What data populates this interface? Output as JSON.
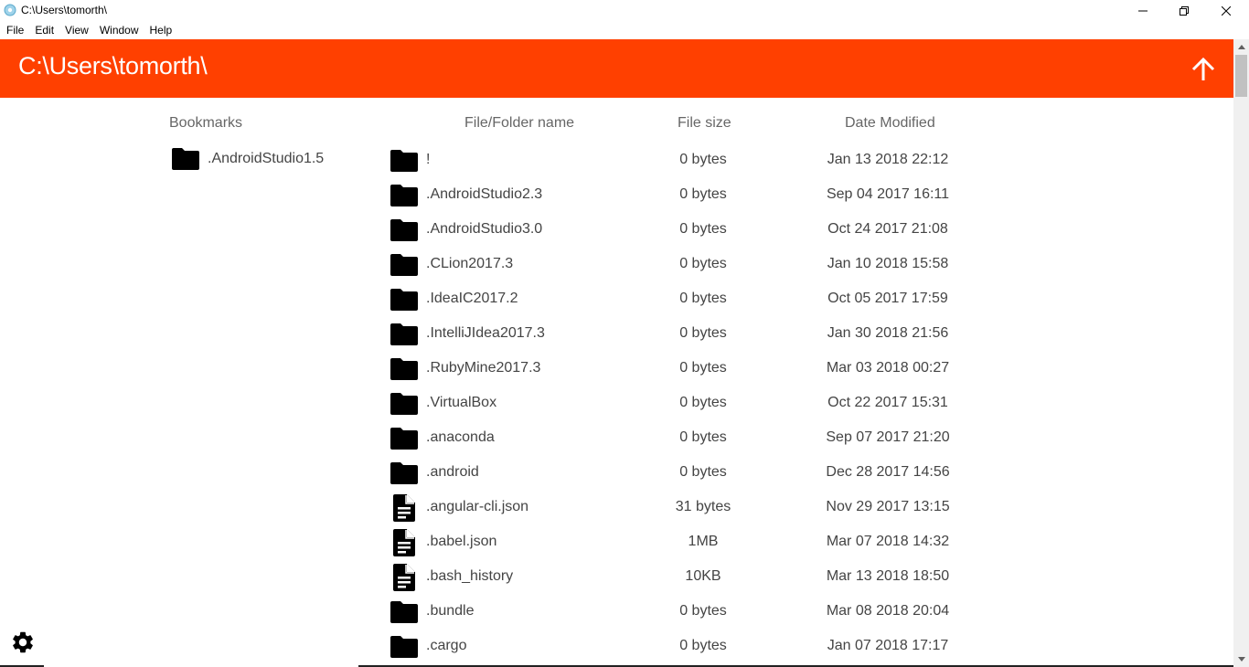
{
  "window": {
    "title": "C:\\Users\\tomorth\\",
    "icon": "app-icon",
    "controls": [
      "minimize",
      "maximize",
      "close"
    ]
  },
  "menu": {
    "items": [
      "File",
      "Edit",
      "View",
      "Window",
      "Help"
    ]
  },
  "header": {
    "path": "C:\\Users\\tomorth\\",
    "up_icon": "arrow-up-icon",
    "color": "#ff4000"
  },
  "columns": {
    "bookmarks": "Bookmarks",
    "name": "File/Folder name",
    "size": "File size",
    "date": "Date Modified"
  },
  "bookmarks": [
    {
      "label": ".AndroidStudio1.5",
      "icon": "folder-icon"
    }
  ],
  "files": [
    {
      "name": "!",
      "type": "folder",
      "size": "0 bytes",
      "date": "Jan 13 2018 22:12"
    },
    {
      "name": ".AndroidStudio2.3",
      "type": "folder",
      "size": "0 bytes",
      "date": "Sep 04 2017 16:11"
    },
    {
      "name": ".AndroidStudio3.0",
      "type": "folder",
      "size": "0 bytes",
      "date": "Oct 24 2017 21:08"
    },
    {
      "name": ".CLion2017.3",
      "type": "folder",
      "size": "0 bytes",
      "date": "Jan 10 2018 15:58"
    },
    {
      "name": ".IdeaIC2017.2",
      "type": "folder",
      "size": "0 bytes",
      "date": "Oct 05 2017 17:59"
    },
    {
      "name": ".IntelliJIdea2017.3",
      "type": "folder",
      "size": "0 bytes",
      "date": "Jan 30 2018 21:56"
    },
    {
      "name": ".RubyMine2017.3",
      "type": "folder",
      "size": "0 bytes",
      "date": "Mar 03 2018 00:27"
    },
    {
      "name": ".VirtualBox",
      "type": "folder",
      "size": "0 bytes",
      "date": "Oct 22 2017 15:31"
    },
    {
      "name": ".anaconda",
      "type": "folder",
      "size": "0 bytes",
      "date": "Sep 07 2017 21:20"
    },
    {
      "name": ".android",
      "type": "folder",
      "size": "0 bytes",
      "date": "Dec 28 2017 14:56"
    },
    {
      "name": ".angular-cli.json",
      "type": "file",
      "size": "31 bytes",
      "date": "Nov 29 2017 13:15"
    },
    {
      "name": ".babel.json",
      "type": "file",
      "size": "1MB",
      "date": "Mar 07 2018 14:32"
    },
    {
      "name": ".bash_history",
      "type": "file",
      "size": "10KB",
      "date": "Mar 13 2018 18:50"
    },
    {
      "name": ".bundle",
      "type": "folder",
      "size": "0 bytes",
      "date": "Mar 08 2018 20:04"
    },
    {
      "name": ".cargo",
      "type": "folder",
      "size": "0 bytes",
      "date": "Jan 07 2018 17:17"
    }
  ],
  "footer": {
    "settings_icon": "gear-icon"
  }
}
